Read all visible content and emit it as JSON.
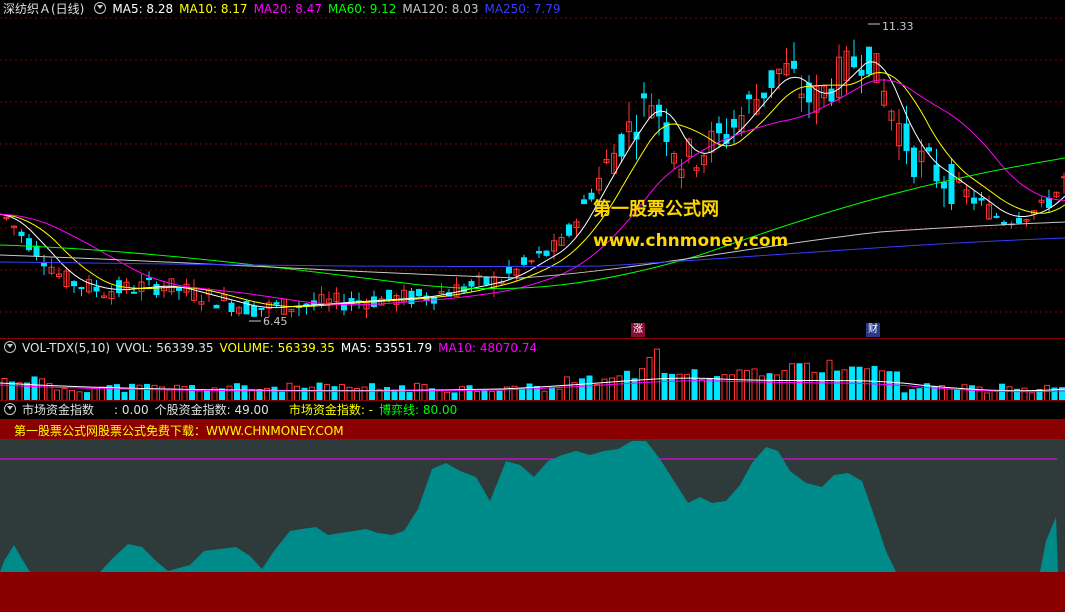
{
  "main": {
    "stock_title": "深纺织Ａ(日线)",
    "ma": [
      {
        "label": "MA5: 8.28",
        "color": "#ffffff"
      },
      {
        "label": "MA10: 8.17",
        "color": "#ffff00"
      },
      {
        "label": "MA20: 8.47",
        "color": "#ff00ff"
      },
      {
        "label": "MA60: 9.12",
        "color": "#00ff00"
      },
      {
        "label": "MA120: 8.03",
        "color": "#c8c8c8"
      },
      {
        "label": "MA250: 7.79",
        "color": "#3b3bff"
      }
    ],
    "high_label": "11.33",
    "low_label": "6.45",
    "marker_zhang": "涨",
    "marker_cai": "财",
    "watermark_cn": "第一股票公式网",
    "watermark_en": "www.chnmoney.com"
  },
  "volume": {
    "name": "VOL-TDX(5,10)",
    "vvol": "VVOL: 56339.35",
    "volume": "VOLUME: 56339.35",
    "ma5": "MA5: 53551.79",
    "ma10": "MA10: 48070.74"
  },
  "fund": {
    "name": "市场资金指数",
    "value": ": 0.00",
    "stock_index": "个股资金指数: 49.00",
    "market_index": "市场资金指数: -",
    "game_line": "博弈线: 80.00",
    "banner": "第一股票公式网股票公式免费下载：WWW.CHNMONEY.COM"
  },
  "colors": {
    "up": "#ff3232",
    "down": "#00e5ff",
    "grid": "#8b0000",
    "area": "#008b8b",
    "area_bg": "#2f3a3a"
  }
}
